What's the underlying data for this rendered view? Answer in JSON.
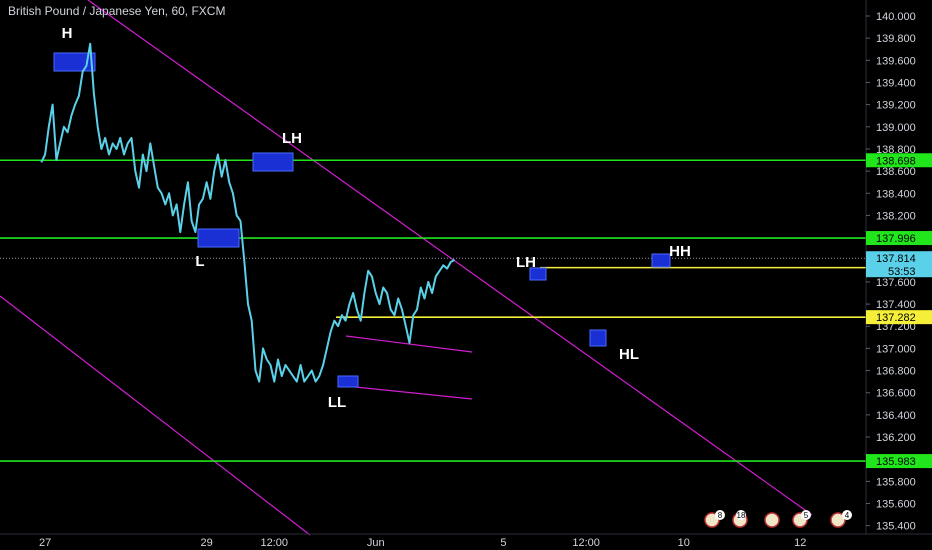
{
  "symbol_title": "British Pound / Japanese Yen, 60, FXCM",
  "colors": {
    "background": "#000000",
    "price_line": "#5ad1e8",
    "support_green": "#21e61b",
    "level_yellow": "#f5ef3a",
    "channel_magenta": "#d11ed1",
    "pattern_box_fill": "#1a2fd4",
    "pattern_box_stroke": "#4a6bff",
    "axis_text": "#d1d4dc",
    "last_price_bg": "#5ad1e8"
  },
  "chart_data": {
    "type": "line",
    "title": "British Pound / Japanese Yen, 60, FXCM",
    "ylim": [
      135.35,
      140.1
    ],
    "y_ticks": [
      135.4,
      135.6,
      135.8,
      136.0,
      136.2,
      136.4,
      136.6,
      136.8,
      137.0,
      137.2,
      137.4,
      137.6,
      137.8,
      138.0,
      138.2,
      138.4,
      138.6,
      138.8,
      139.0,
      139.2,
      139.4,
      139.6,
      139.8,
      140.0
    ],
    "y_tick_labels": [
      "135.400",
      "135.600",
      "135.800",
      "136.000",
      "136.200",
      "136.400",
      "136.600",
      "136.800",
      "137.000",
      "137.200",
      "137.400",
      "137.600",
      "137.800",
      "138.000",
      "138.200",
      "138.400",
      "138.600",
      "138.800",
      "139.000",
      "139.200",
      "139.400",
      "139.600",
      "139.800",
      "140.000"
    ],
    "x_ticks": [
      {
        "label": "27",
        "x": 1
      },
      {
        "label": "29",
        "x": 44
      },
      {
        "label": "12:00",
        "x": 62
      },
      {
        "label": "Jun",
        "x": 89
      },
      {
        "label": "5",
        "x": 123
      },
      {
        "label": "12:00",
        "x": 145
      },
      {
        "label": "10",
        "x": 171
      },
      {
        "label": "12",
        "x": 202
      }
    ],
    "xlim": [
      -11,
      219.5
    ],
    "series": [
      {
        "values": [
          [
            0,
            138.68
          ],
          [
            1,
            138.75
          ],
          [
            2,
            139.0
          ],
          [
            3,
            139.2
          ],
          [
            4,
            138.7
          ],
          [
            5,
            138.85
          ],
          [
            6,
            139.0
          ],
          [
            7,
            138.95
          ],
          [
            8,
            139.1
          ],
          [
            9,
            139.2
          ],
          [
            10,
            139.28
          ],
          [
            11,
            139.5
          ],
          [
            12,
            139.55
          ],
          [
            13,
            139.75
          ],
          [
            14,
            139.3
          ],
          [
            15,
            139.0
          ],
          [
            16,
            138.8
          ],
          [
            17,
            138.9
          ],
          [
            18,
            138.75
          ],
          [
            19,
            138.85
          ],
          [
            20,
            138.8
          ],
          [
            21,
            138.9
          ],
          [
            22,
            138.75
          ],
          [
            23,
            138.85
          ],
          [
            24,
            138.9
          ],
          [
            25,
            138.6
          ],
          [
            26,
            138.45
          ],
          [
            27,
            138.75
          ],
          [
            28,
            138.6
          ],
          [
            29,
            138.85
          ],
          [
            30,
            138.65
          ],
          [
            31,
            138.45
          ],
          [
            32,
            138.4
          ],
          [
            33,
            138.3
          ],
          [
            34,
            138.4
          ],
          [
            35,
            138.2
          ],
          [
            36,
            138.3
          ],
          [
            37,
            138.05
          ],
          [
            38,
            138.3
          ],
          [
            39,
            138.5
          ],
          [
            40,
            138.15
          ],
          [
            41,
            138.05
          ],
          [
            42,
            138.3
          ],
          [
            43,
            138.35
          ],
          [
            44,
            138.5
          ],
          [
            45,
            138.35
          ],
          [
            46,
            138.6
          ],
          [
            47,
            138.75
          ],
          [
            48,
            138.55
          ],
          [
            49,
            138.7
          ],
          [
            50,
            138.5
          ],
          [
            51,
            138.4
          ],
          [
            52,
            138.2
          ],
          [
            53,
            138.15
          ],
          [
            54,
            137.8
          ],
          [
            55,
            137.4
          ],
          [
            56,
            137.25
          ],
          [
            57,
            136.8
          ],
          [
            58,
            136.7
          ],
          [
            59,
            137.0
          ],
          [
            60,
            136.9
          ],
          [
            61,
            136.85
          ],
          [
            62,
            136.7
          ],
          [
            63,
            136.9
          ],
          [
            64,
            136.75
          ],
          [
            65,
            136.85
          ],
          [
            66,
            136.8
          ],
          [
            67,
            136.75
          ],
          [
            68,
            136.7
          ],
          [
            69,
            136.85
          ],
          [
            70,
            136.7
          ],
          [
            71,
            136.75
          ],
          [
            72,
            136.8
          ],
          [
            73,
            136.7
          ],
          [
            74,
            136.75
          ],
          [
            75,
            136.85
          ],
          [
            76,
            137.0
          ],
          [
            77,
            137.15
          ],
          [
            78,
            137.25
          ],
          [
            79,
            137.2
          ],
          [
            80,
            137.3
          ],
          [
            81,
            137.25
          ],
          [
            82,
            137.4
          ],
          [
            83,
            137.5
          ],
          [
            84,
            137.35
          ],
          [
            85,
            137.25
          ],
          [
            86,
            137.5
          ],
          [
            87,
            137.7
          ],
          [
            88,
            137.65
          ],
          [
            89,
            137.5
          ],
          [
            90,
            137.4
          ],
          [
            91,
            137.55
          ],
          [
            92,
            137.5
          ],
          [
            93,
            137.35
          ],
          [
            94,
            137.3
          ],
          [
            95,
            137.45
          ],
          [
            96,
            137.35
          ],
          [
            97,
            137.2
          ],
          [
            98,
            137.05
          ],
          [
            99,
            137.3
          ],
          [
            100,
            137.35
          ],
          [
            101,
            137.55
          ],
          [
            102,
            137.45
          ],
          [
            103,
            137.6
          ],
          [
            104,
            137.5
          ],
          [
            105,
            137.65
          ],
          [
            106,
            137.7
          ],
          [
            107,
            137.75
          ],
          [
            108,
            137.72
          ],
          [
            109,
            137.78
          ],
          [
            110,
            137.8
          ]
        ]
      }
    ],
    "levels": [
      {
        "value": 138.698,
        "label": "138.698",
        "color": "green"
      },
      {
        "value": 137.996,
        "label": "137.996",
        "color": "green"
      },
      {
        "value": 135.983,
        "label": "135.983",
        "color": "green"
      },
      {
        "value": 137.729,
        "label": "137.729",
        "color": "yellow"
      },
      {
        "value": 137.282,
        "label": "137.282",
        "color": "yellow"
      }
    ],
    "last_price": {
      "value": 137.814,
      "label": "137.814",
      "countdown": "53:53"
    },
    "annotations": [
      {
        "text": "H"
      },
      {
        "text": "LH"
      },
      {
        "text": "L"
      },
      {
        "text": "LL"
      },
      {
        "text": "LH"
      },
      {
        "text": "HH"
      },
      {
        "text": "HL"
      }
    ],
    "event_badges": [
      "8",
      "18",
      "5",
      "4"
    ]
  }
}
